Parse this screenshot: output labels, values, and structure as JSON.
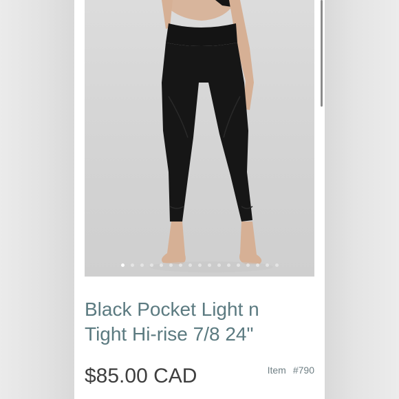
{
  "product": {
    "title_line1": "Black Pocket Light n",
    "title_line2": "Tight Hi-rise 7/8 24\"",
    "price": "$85.00 CAD",
    "item_label": "Item",
    "item_number": "#790"
  },
  "carousel": {
    "total_dots": 17,
    "active_index": 0
  },
  "colors": {
    "title": "#5b7a80",
    "price": "#3e3e3e",
    "leggings": "#161616",
    "photo_bg": "#d6d6d6"
  }
}
